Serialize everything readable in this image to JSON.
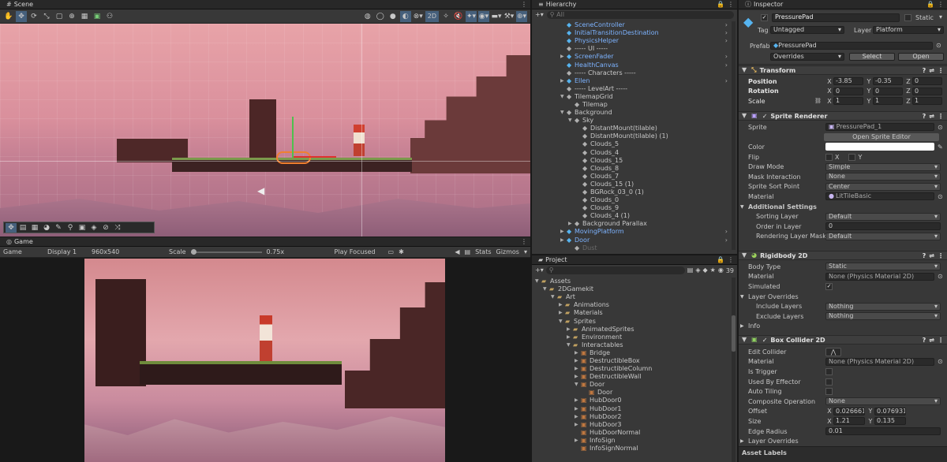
{
  "scene": {
    "tab": "Scene",
    "btn_2d": "2D"
  },
  "game": {
    "tab": "Game",
    "mode": "Game",
    "display": "Display 1",
    "resolution": "960x540",
    "scale_label": "Scale",
    "scale_value": "0.75x",
    "play_focused": "Play Focused",
    "stats": "Stats",
    "gizmos": "Gizmos"
  },
  "hierarchy": {
    "tab": "Hierarchy",
    "search_placeholder": "All",
    "items": [
      {
        "label": "SceneController",
        "indent": 1,
        "color": "blue",
        "icon": "cube",
        "arrow": ""
      },
      {
        "label": "InitialTransitionDestination",
        "indent": 1,
        "color": "blue",
        "icon": "cube",
        "arrow": ""
      },
      {
        "label": "PhysicsHelper",
        "indent": 1,
        "color": "blue",
        "icon": "cube",
        "arrow": ""
      },
      {
        "label": "----- UI -----",
        "indent": 1,
        "color": "gray",
        "icon": "cube-gray",
        "arrow": ""
      },
      {
        "label": "ScreenFader",
        "indent": 1,
        "color": "blue",
        "icon": "cube",
        "arrow": "▶"
      },
      {
        "label": "HealthCanvas",
        "indent": 1,
        "color": "blue",
        "icon": "cube",
        "arrow": ""
      },
      {
        "label": "----- Characters -----",
        "indent": 1,
        "color": "gray",
        "icon": "cube-gray",
        "arrow": ""
      },
      {
        "label": "Ellen",
        "indent": 1,
        "color": "blue",
        "icon": "cube",
        "arrow": "▶"
      },
      {
        "label": "----- LevelArt -----",
        "indent": 1,
        "color": "gray",
        "icon": "cube-gray",
        "arrow": ""
      },
      {
        "label": "TilemapGrid",
        "indent": 1,
        "color": "gray",
        "icon": "cube-gray",
        "arrow": "▼"
      },
      {
        "label": "Tilemap",
        "indent": 2,
        "color": "gray",
        "icon": "cube-gray",
        "arrow": ""
      },
      {
        "label": "Background",
        "indent": 1,
        "color": "gray",
        "icon": "cube-gray",
        "arrow": "▼"
      },
      {
        "label": "Sky",
        "indent": 2,
        "color": "gray",
        "icon": "cube-gray",
        "arrow": "▼"
      },
      {
        "label": "DistantMount(tilable)",
        "indent": 3,
        "color": "gray",
        "icon": "cube-gray",
        "arrow": ""
      },
      {
        "label": "DistantMount(tilable) (1)",
        "indent": 3,
        "color": "gray",
        "icon": "cube-gray",
        "arrow": ""
      },
      {
        "label": "Clouds_5",
        "indent": 3,
        "color": "gray",
        "icon": "cube-gray",
        "arrow": ""
      },
      {
        "label": "Clouds_4",
        "indent": 3,
        "color": "gray",
        "icon": "cube-gray",
        "arrow": ""
      },
      {
        "label": "Clouds_15",
        "indent": 3,
        "color": "gray",
        "icon": "cube-gray",
        "arrow": ""
      },
      {
        "label": "Clouds_8",
        "indent": 3,
        "color": "gray",
        "icon": "cube-gray",
        "arrow": ""
      },
      {
        "label": "Clouds_7",
        "indent": 3,
        "color": "gray",
        "icon": "cube-gray",
        "arrow": ""
      },
      {
        "label": "Clouds_15 (1)",
        "indent": 3,
        "color": "gray",
        "icon": "cube-gray",
        "arrow": ""
      },
      {
        "label": "BGRock_03_0 (1)",
        "indent": 3,
        "color": "gray",
        "icon": "cube-gray",
        "arrow": ""
      },
      {
        "label": "Clouds_0",
        "indent": 3,
        "color": "gray",
        "icon": "cube-gray",
        "arrow": ""
      },
      {
        "label": "Clouds_9",
        "indent": 3,
        "color": "gray",
        "icon": "cube-gray",
        "arrow": ""
      },
      {
        "label": "Clouds_4 (1)",
        "indent": 3,
        "color": "gray",
        "icon": "cube-gray",
        "arrow": ""
      },
      {
        "label": "Background Parallax",
        "indent": 2,
        "color": "gray",
        "icon": "cube-gray",
        "arrow": "▶"
      },
      {
        "label": "MovingPlatform",
        "indent": 1,
        "color": "blue",
        "icon": "cube",
        "arrow": "▶"
      },
      {
        "label": "Door",
        "indent": 1,
        "color": "blue",
        "icon": "cube",
        "arrow": "▶"
      },
      {
        "label": "Dust",
        "indent": 2,
        "color": "dim",
        "icon": "cube-gray",
        "arrow": ""
      }
    ]
  },
  "project": {
    "tab": "Project",
    "count": "39",
    "items": [
      {
        "label": "Assets",
        "indent": 0,
        "arrow": "▼",
        "icon": "folder"
      },
      {
        "label": "2DGamekit",
        "indent": 1,
        "arrow": "▼",
        "icon": "folder"
      },
      {
        "label": "Art",
        "indent": 2,
        "arrow": "▼",
        "icon": "folder"
      },
      {
        "label": "Animations",
        "indent": 3,
        "arrow": "▶",
        "icon": "folder"
      },
      {
        "label": "Materials",
        "indent": 3,
        "arrow": "▶",
        "icon": "folder"
      },
      {
        "label": "Sprites",
        "indent": 3,
        "arrow": "▼",
        "icon": "folder"
      },
      {
        "label": "AnimatedSprites",
        "indent": 4,
        "arrow": "▶",
        "icon": "folder"
      },
      {
        "label": "Environment",
        "indent": 4,
        "arrow": "▶",
        "icon": "folder"
      },
      {
        "label": "Interactables",
        "indent": 4,
        "arrow": "▼",
        "icon": "folder"
      },
      {
        "label": "Bridge",
        "indent": 5,
        "arrow": "▶",
        "icon": "sprite"
      },
      {
        "label": "DestructibleBox",
        "indent": 5,
        "arrow": "▶",
        "icon": "sprite"
      },
      {
        "label": "DestructibleColumn",
        "indent": 5,
        "arrow": "▶",
        "icon": "sprite"
      },
      {
        "label": "DestructibleWall",
        "indent": 5,
        "arrow": "▶",
        "icon": "sprite"
      },
      {
        "label": "Door",
        "indent": 5,
        "arrow": "▼",
        "icon": "sprite"
      },
      {
        "label": "Door",
        "indent": 6,
        "arrow": "",
        "icon": "sprite"
      },
      {
        "label": "HubDoor0",
        "indent": 5,
        "arrow": "▶",
        "icon": "sprite"
      },
      {
        "label": "HubDoor1",
        "indent": 5,
        "arrow": "▶",
        "icon": "sprite"
      },
      {
        "label": "HubDoor2",
        "indent": 5,
        "arrow": "▶",
        "icon": "sprite"
      },
      {
        "label": "HubDoor3",
        "indent": 5,
        "arrow": "▶",
        "icon": "sprite"
      },
      {
        "label": "HubDoorNormal",
        "indent": 5,
        "arrow": "",
        "icon": "sprite"
      },
      {
        "label": "InfoSign",
        "indent": 5,
        "arrow": "▶",
        "icon": "sprite"
      },
      {
        "label": "InfoSignNormal",
        "indent": 5,
        "arrow": "",
        "icon": "sprite"
      }
    ]
  },
  "inspector": {
    "tab": "Inspector",
    "name": "PressurePad",
    "static": "Static",
    "tag_label": "Tag",
    "tag_value": "Untagged",
    "layer_label": "Layer",
    "layer_value": "Platform",
    "prefab_label": "Prefab",
    "prefab_value": "PressurePad",
    "overrides": "Overrides",
    "select": "Select",
    "open": "Open",
    "transform": {
      "title": "Transform",
      "position": "Position",
      "rotation": "Rotation",
      "scale": "Scale",
      "pos": [
        "-3.85",
        "-0.35",
        "0"
      ],
      "rot": [
        "0",
        "0",
        "0"
      ],
      "scl": [
        "1",
        "1",
        "1"
      ],
      "x": "X",
      "y": "Y",
      "z": "Z"
    },
    "sprite_renderer": {
      "title": "Sprite Renderer",
      "sprite_label": "Sprite",
      "sprite_value": "PressurePad_1",
      "open_editor": "Open Sprite Editor",
      "color": "Color",
      "flip": "Flip",
      "flip_x": "X",
      "flip_y": "Y",
      "draw_mode": "Draw Mode",
      "draw_mode_value": "Simple",
      "mask": "Mask Interaction",
      "mask_value": "None",
      "sort_point": "Sprite Sort Point",
      "sort_point_value": "Center",
      "material": "Material",
      "material_value": "LitTileBasic",
      "additional": "Additional Settings",
      "sorting_layer": "Sorting Layer",
      "sorting_layer_value": "Default",
      "order": "Order in Layer",
      "order_value": "0",
      "rlm": "Rendering Layer Mask",
      "rlm_value": "Default"
    },
    "rigidbody": {
      "title": "Rigidbody 2D",
      "body_type": "Body Type",
      "body_type_value": "Static",
      "material": "Material",
      "material_value": "None (Physics Material 2D)",
      "simulated": "Simulated",
      "layer_overrides": "Layer Overrides",
      "include": "Include Layers",
      "include_value": "Nothing",
      "exclude": "Exclude Layers",
      "exclude_value": "Nothing",
      "info": "Info"
    },
    "box_collider": {
      "title": "Box Collider 2D",
      "edit": "Edit Collider",
      "material": "Material",
      "material_value": "None (Physics Material 2D)",
      "is_trigger": "Is Trigger",
      "used_by_effector": "Used By Effector",
      "auto_tiling": "Auto Tiling",
      "composite": "Composite Operation",
      "composite_value": "None",
      "offset": "Offset",
      "offset_x": "0.026661",
      "offset_y": "0.0769318",
      "size": "Size",
      "size_x": "1.21",
      "size_y": "0.135",
      "edge_radius": "Edge Radius",
      "edge_radius_value": "0.01",
      "layer_overrides": "Layer Overrides"
    },
    "asset_labels": "Asset Labels"
  },
  "colors": {
    "accent": "#2c5d87",
    "blue_text": "#7db3ff",
    "bg_panel": "#383838"
  }
}
